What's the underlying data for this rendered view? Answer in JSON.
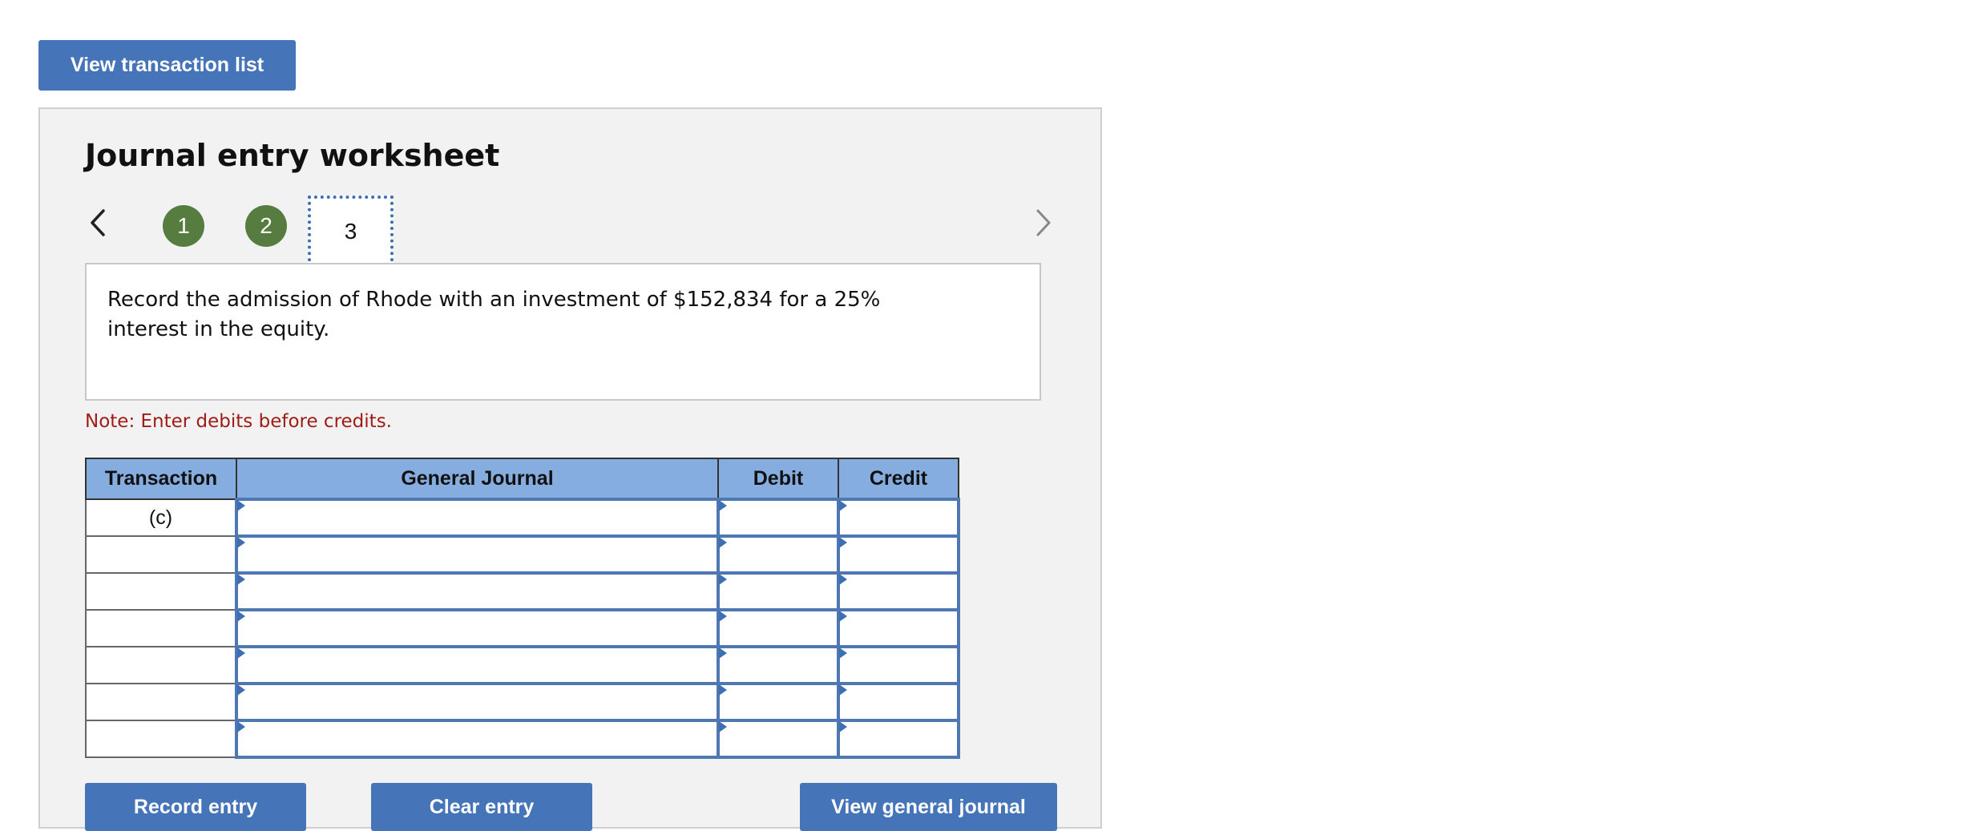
{
  "header": {
    "view_transaction_list_label": "View transaction list"
  },
  "worksheet": {
    "title": "Journal entry worksheet",
    "steps": [
      "1",
      "2",
      "3"
    ],
    "active_step": "3",
    "description": "Record the admission of Rhode with an investment of $152,834 for a 25% interest in the equity.",
    "note": "Note: Enter debits before credits.",
    "table": {
      "columns": [
        "Transaction",
        "General Journal",
        "Debit",
        "Credit"
      ],
      "rows": [
        {
          "transaction": "(c)",
          "account": "",
          "debit": "",
          "credit": ""
        },
        {
          "transaction": "",
          "account": "",
          "debit": "",
          "credit": ""
        },
        {
          "transaction": "",
          "account": "",
          "debit": "",
          "credit": ""
        },
        {
          "transaction": "",
          "account": "",
          "debit": "",
          "credit": ""
        },
        {
          "transaction": "",
          "account": "",
          "debit": "",
          "credit": ""
        },
        {
          "transaction": "",
          "account": "",
          "debit": "",
          "credit": ""
        },
        {
          "transaction": "",
          "account": "",
          "debit": "",
          "credit": ""
        }
      ]
    },
    "buttons": {
      "record": "Record entry",
      "clear": "Clear entry",
      "view_general_journal": "View general journal"
    }
  },
  "colors": {
    "button_blue": "#4674b8",
    "header_blue": "#85ade0",
    "step_complete_green": "#567d3f",
    "note_red": "#a01c16"
  },
  "icons": {
    "prev": "chevron-left-icon",
    "next": "chevron-right-icon"
  }
}
